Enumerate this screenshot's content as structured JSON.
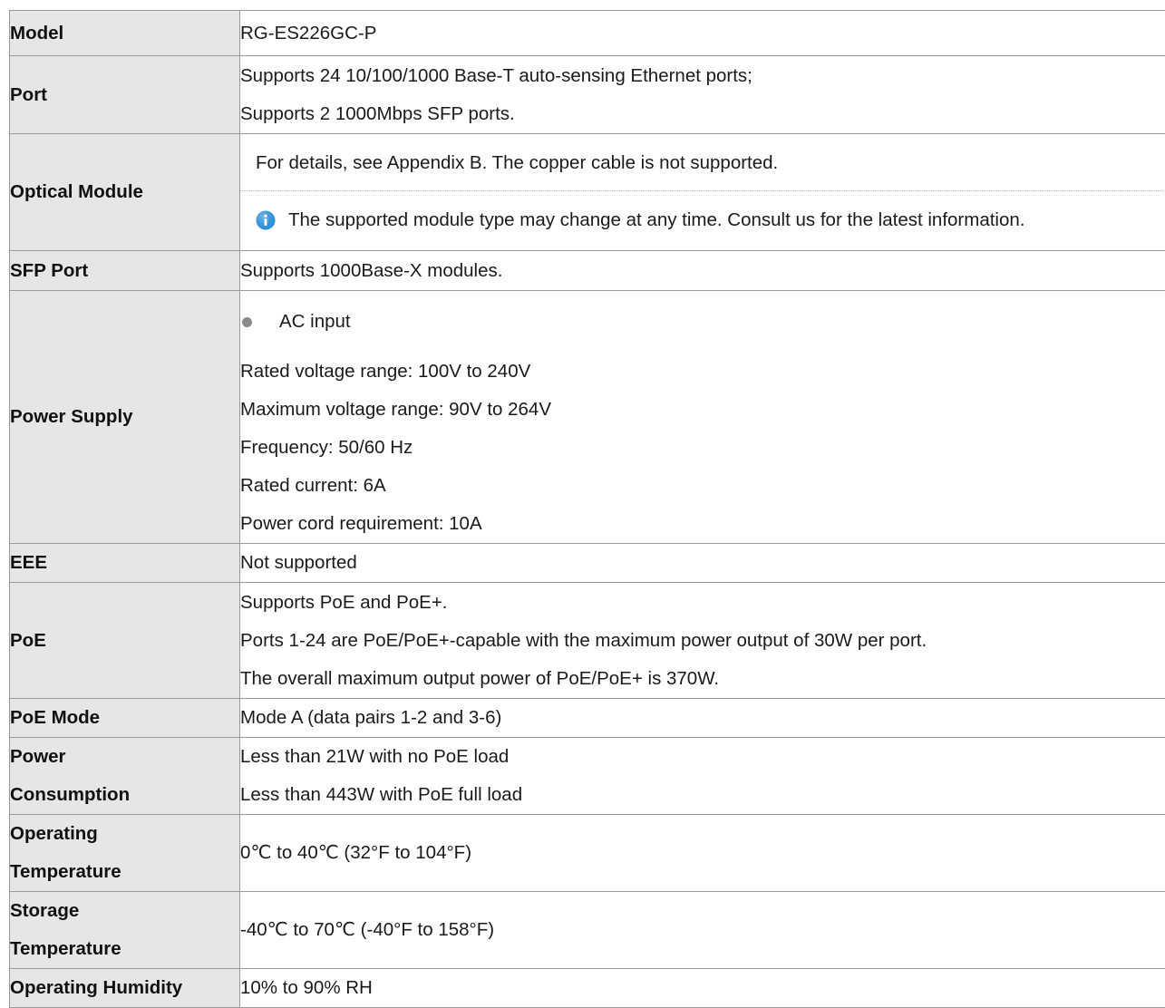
{
  "rows": {
    "model": {
      "label": "Model",
      "value": "RG-ES226GC-P"
    },
    "port": {
      "label": "Port",
      "lines": [
        "Supports 24 10/100/1000 Base-T auto-sensing Ethernet ports;",
        "Supports 2 1000Mbps SFP ports."
      ]
    },
    "optical": {
      "label": "Optical Module",
      "text": "For details, see Appendix B. The copper cable is not supported.",
      "note": "The supported module type may change at any time. Consult us for the latest information.",
      "note_icon": "info-icon",
      "note_icon_color": "#2a8fd6"
    },
    "sfp": {
      "label": "SFP Port",
      "value": "Supports 1000Base-X modules."
    },
    "power_supply": {
      "label": "Power Supply",
      "bullet": "AC input",
      "lines": [
        "Rated voltage range: 100V to 240V",
        "Maximum voltage range: 90V to 264V",
        "Frequency: 50/60 Hz",
        "Rated current: 6A",
        "Power cord requirement: 10A"
      ]
    },
    "eee": {
      "label": "EEE",
      "value": "Not supported"
    },
    "poe": {
      "label": "PoE",
      "lines": [
        "Supports PoE and PoE+.",
        "Ports 1-24 are PoE/PoE+-capable with the maximum power output of 30W per port.",
        "The overall maximum output power of PoE/PoE+ is 370W."
      ]
    },
    "poe_mode": {
      "label": "PoE Mode",
      "value": "Mode A (data pairs 1-2 and 3-6)"
    },
    "power_consumption": {
      "label_lines": [
        "Power",
        "Consumption"
      ],
      "lines": [
        "Less than 21W with no PoE load",
        "Less than 443W with PoE full load"
      ]
    },
    "operating_temp": {
      "label_lines": [
        "Operating",
        "Temperature"
      ],
      "value": "0℃  to 40℃  (32°F to 104°F)"
    },
    "storage_temp": {
      "label_lines": [
        "Storage",
        "Temperature"
      ],
      "value": "-40℃  to 70℃  (-40°F to 158°F)"
    },
    "operating_humidity": {
      "label": "Operating Humidity",
      "value": "10% to 90% RH"
    }
  }
}
